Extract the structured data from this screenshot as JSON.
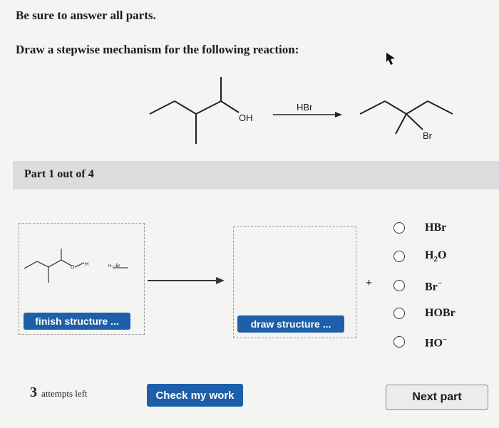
{
  "instructions": {
    "line1": "Be sure to answer all parts.",
    "line2": "Draw a stepwise mechanism for the following reaction:"
  },
  "reaction": {
    "oh_label": "OH",
    "reagent": "HBr",
    "br_label": "Br"
  },
  "part": {
    "label": "Part 1 out of 4"
  },
  "workspace": {
    "h_label": "H",
    "o_label": "O",
    "hbr_small": "H—Br",
    "finish_button": "finish structure ...",
    "draw_button": "draw structure ...",
    "plus": "+"
  },
  "options": [
    {
      "base": "HBr",
      "sub": "",
      "tail": "",
      "sup": ""
    },
    {
      "base": "H",
      "sub": "2",
      "tail": "O",
      "sup": ""
    },
    {
      "base": "Br",
      "sub": "",
      "tail": "",
      "sup": "−"
    },
    {
      "base": "HOBr",
      "sub": "",
      "tail": "",
      "sup": ""
    },
    {
      "base": "HO",
      "sub": "",
      "tail": "",
      "sup": "−"
    }
  ],
  "footer": {
    "attempts_count": "3",
    "attempts_text": "attempts left",
    "check_button": "Check my work",
    "next_button": "Next part"
  }
}
